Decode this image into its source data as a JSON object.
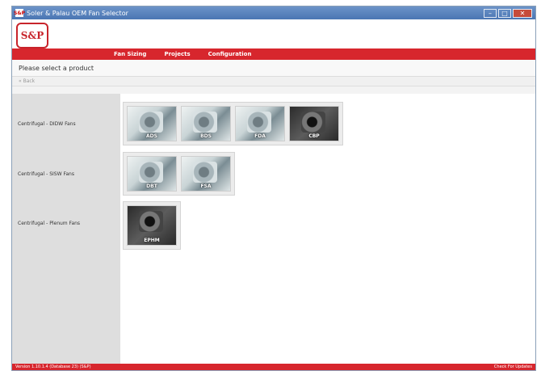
{
  "window": {
    "title": "Soler & Palau OEM Fan Selector",
    "app_icon": "S&P",
    "controls": {
      "minimize": "–",
      "maximize": "□",
      "close": "✕"
    }
  },
  "logo": {
    "text": "S&P"
  },
  "menu": {
    "items": [
      "Fan Sizing",
      "Projects",
      "Configuration"
    ]
  },
  "prompt": "Please select a product",
  "back": "« Back",
  "categories": [
    {
      "label": "Centrifugal - DIDW Fans",
      "products": [
        "ADS",
        "BDS",
        "FDA",
        "CBP"
      ]
    },
    {
      "label": "Centrifugal - SISW Fans",
      "products": [
        "DBT",
        "FSA"
      ]
    },
    {
      "label": "Centrifugal - Plenum Fans",
      "products": [
        "EPHM"
      ]
    }
  ],
  "status": {
    "version": "Version 1.10.1.4 (Database 23) (S&P)",
    "updates": "Check For Updates"
  },
  "colors": {
    "brand_red": "#d7262d",
    "titlebar_blue": "#4a76b3"
  }
}
